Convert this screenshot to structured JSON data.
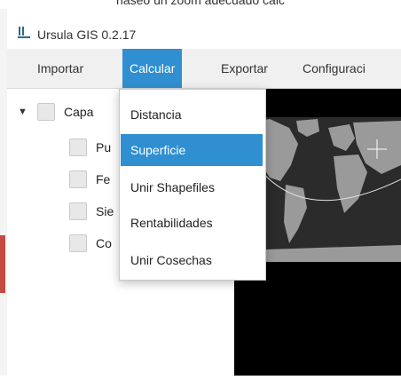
{
  "window": {
    "title": "Ursula GIS 0.2.17"
  },
  "caption": {
    "text": "naseo un zoom adecuado calc"
  },
  "menubar": {
    "items": [
      "Importar",
      "Calcular",
      "Exportar",
      "Configuraci"
    ]
  },
  "menu": {
    "open": "Calcular",
    "items": [
      "Distancia",
      "Superficie",
      "Unir Shapefiles",
      "Rentabilidades",
      "Unir Cosechas"
    ],
    "selected": "Superficie"
  },
  "layers": {
    "root_label": "Capa",
    "items": [
      "Pu",
      "Fe",
      "Sie",
      "Co"
    ]
  },
  "colors": {
    "accent": "#2f8fd1",
    "map_background": "#000000",
    "land": "#9a9a9a"
  }
}
